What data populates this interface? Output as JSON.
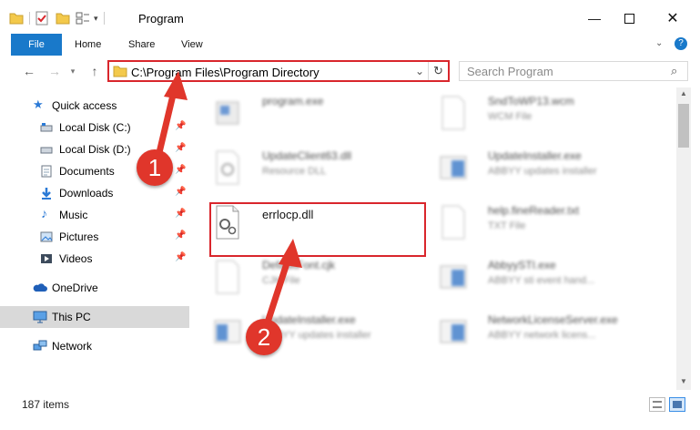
{
  "window": {
    "title": "Program"
  },
  "ribbon": {
    "tabs": [
      "File",
      "Home",
      "Share",
      "View"
    ]
  },
  "address_bar": {
    "path": "C:\\Program Files\\Program Directory"
  },
  "search": {
    "placeholder": "Search Program"
  },
  "sidebar": {
    "items": [
      {
        "label": "Quick access",
        "icon": "star-icon"
      },
      {
        "label": "Local Disk (C:)",
        "icon": "drive-icon",
        "pinned": true
      },
      {
        "label": "Local Disk (D:)",
        "icon": "drive-icon",
        "pinned": true
      },
      {
        "label": "Documents",
        "icon": "documents-icon",
        "pinned": true
      },
      {
        "label": "Downloads",
        "icon": "downloads-icon",
        "pinned": true
      },
      {
        "label": "Music",
        "icon": "music-icon",
        "pinned": true
      },
      {
        "label": "Pictures",
        "icon": "pictures-icon",
        "pinned": true
      },
      {
        "label": "Videos",
        "icon": "videos-icon",
        "pinned": true
      },
      {
        "label": "OneDrive",
        "icon": "cloud-icon"
      },
      {
        "label": "This PC",
        "icon": "computer-icon",
        "selected": true
      },
      {
        "label": "Network",
        "icon": "network-icon"
      }
    ]
  },
  "files": {
    "left": [
      {
        "name": "program.exe",
        "desc": ""
      },
      {
        "name": "UpdateClient63.dll",
        "desc": "Resource DLL"
      },
      {
        "name": "errlocp.dll",
        "desc": ""
      },
      {
        "name": "DefaultFont.cjk",
        "desc": "CJK File"
      },
      {
        "name": "UpdateInstaller.exe",
        "desc": "ABBYY updates installer"
      }
    ],
    "right": [
      {
        "name": "SndToWP13.wcm",
        "desc": "WCM File"
      },
      {
        "name": "UpdateInstaller.exe",
        "desc": "ABBYY updates installer"
      },
      {
        "name": "help.fineReader.txt",
        "desc": "TXT File"
      },
      {
        "name": "AbbyySTI.exe",
        "desc": "ABBYY sti event hand..."
      },
      {
        "name": "NetworkLicenseServer.exe",
        "desc": "ABBYY network licens..."
      }
    ]
  },
  "status": {
    "item_count": "187 items"
  },
  "annotations": {
    "step1": "1",
    "step2": "2",
    "color": "#e0362b"
  }
}
